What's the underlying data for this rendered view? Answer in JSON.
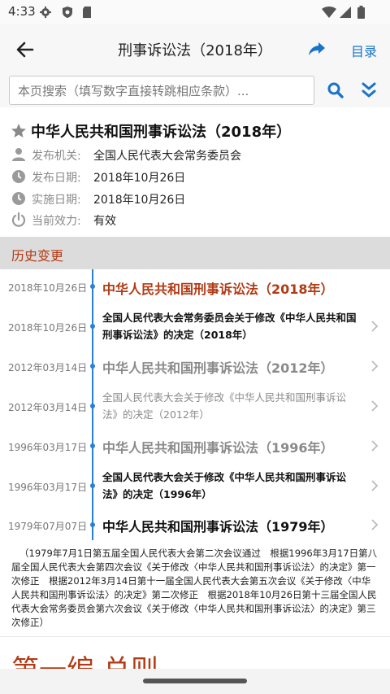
{
  "status_bar": {
    "time": "4:33"
  },
  "app_bar": {
    "title": "刑事诉讼法（2018年）",
    "toc_label": "目录"
  },
  "search": {
    "placeholder": "本页搜索（填写数字直接转跳相应条款）..."
  },
  "law": {
    "title": "中华人民共和国刑事诉讼法（2018年）",
    "meta": [
      {
        "icon": "person-icon",
        "label": "发布机关:",
        "value": "全国人民代表大会常务委员会"
      },
      {
        "icon": "clock-icon",
        "label": "发布日期:",
        "value": "2018年10月26日"
      },
      {
        "icon": "clock-icon",
        "label": "实施日期:",
        "value": "2018年10月26日"
      },
      {
        "icon": "power-icon",
        "label": "当前效力:",
        "value": "有效"
      }
    ]
  },
  "history": {
    "header": "历史变更",
    "items": [
      {
        "date": "2018年10月26日",
        "name": "中华人民共和国刑事诉讼法（2018年）",
        "style": "current"
      },
      {
        "date": "2018年10月26日",
        "name": "全国人民代表大会常务委员会关于修改《中华人民共和国刑事诉讼法》的决定（2018年）",
        "style": "bold"
      },
      {
        "date": "2012年03月14日",
        "name": "中华人民共和国刑事诉讼法（2012年）",
        "style": "grey-b"
      },
      {
        "date": "2012年03月14日",
        "name": "全国人民代表大会关于修改《中华人民共和国刑事诉讼法》的决定（2012年）",
        "style": "grey"
      },
      {
        "date": "1996年03月17日",
        "name": "中华人民共和国刑事诉讼法（1996年）",
        "style": "grey-b"
      },
      {
        "date": "1996年03月17日",
        "name": "全国人民代表大会关于修改《中华人民共和国刑事诉讼法》的决定（1996年）",
        "style": "bold"
      },
      {
        "date": "1979年07月07日",
        "name": "中华人民共和国刑事诉讼法（1979年）",
        "style": "bold"
      }
    ]
  },
  "preamble": "（1979年7月1日第五届全国人民代表大会第二次会议通过　根据1996年3月17日第八届全国人民代表大会第四次会议《关于修改〈中华人民共和国刑事诉讼法〉的决定》第一次修正　根据2012年3月14日第十一届全国人民代表大会第五次会议《关于修改〈中华人民共和国刑事诉讼法〉的决定》第二次修正　根据2018年10月26日第十三届全国人民代表大会常务委员会第六次会议《关于修改〈中华人民共和国刑事诉讼法〉的决定》第三次修正）",
  "part_heading": "第一编 总则",
  "colors": {
    "accent_blue": "#1a73c8",
    "accent_red": "#b23a14",
    "timeline": "#2b7fd6"
  }
}
